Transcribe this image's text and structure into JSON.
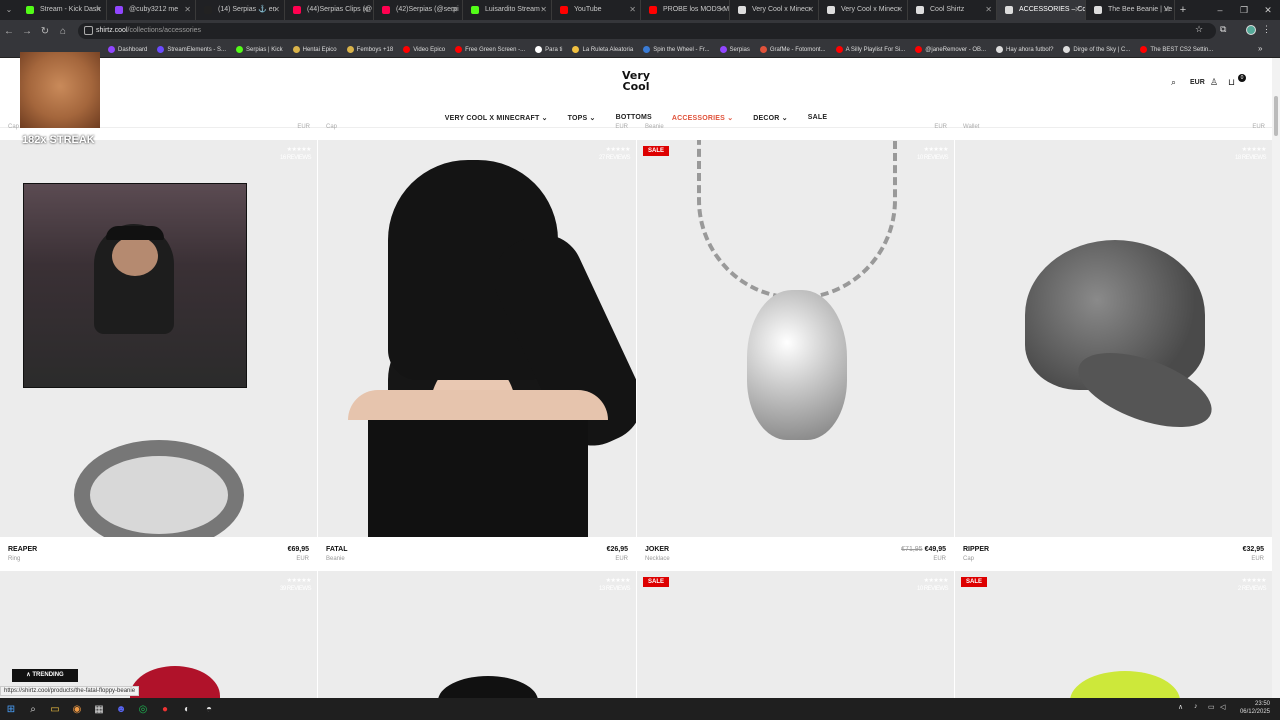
{
  "browser": {
    "tabs": [
      {
        "title": "Stream - Kick Dash",
        "color": "#53fc18"
      },
      {
        "title": "@cuby3212 me",
        "color": "#9146ff"
      },
      {
        "title": "(14) Serpias ⚓ en",
        "color": "#222222"
      },
      {
        "title": "(44)Serpias Clips (@",
        "color": "#ff0050"
      },
      {
        "title": "(42)Serpias (@serpi",
        "color": "#ff0050"
      },
      {
        "title": "Luisardito Stream -",
        "color": "#53fc18"
      },
      {
        "title": "YouTube",
        "color": "#ff0000"
      },
      {
        "title": "PROBE los MODS M",
        "color": "#ff0000"
      },
      {
        "title": "Very Cool x Minecr",
        "color": "#dddddd"
      },
      {
        "title": "Very Cool x Minecr",
        "color": "#dddddd"
      },
      {
        "title": "Cool Shirtz",
        "color": "#dddddd"
      },
      {
        "title": "ACCESSORIES – Coo",
        "color": "#dddddd",
        "active": true
      },
      {
        "title": "The Bee Beanie | Ve",
        "color": "#dddddd"
      }
    ],
    "url_host": "shirtz.cool",
    "url_path": "/collections/accessories",
    "bookmarks": [
      {
        "label": "Dashboard",
        "color": "#9146ff"
      },
      {
        "label": "StreamElements - S...",
        "color": "#6b4bff"
      },
      {
        "label": "Serpias | Kick",
        "color": "#53fc18"
      },
      {
        "label": "Hentai Epico",
        "color": "#d9b34a"
      },
      {
        "label": "Femboys +18",
        "color": "#d9b34a"
      },
      {
        "label": "Video Epico",
        "color": "#ff0000"
      },
      {
        "label": "Free Green Screen -...",
        "color": "#ff0000"
      },
      {
        "label": "Para ti",
        "color": "#ffffff"
      },
      {
        "label": "La Ruleta Aleatoria",
        "color": "#f0c040"
      },
      {
        "label": "Spin the Wheel - Fr...",
        "color": "#3a7bd5"
      },
      {
        "label": "Serpias",
        "color": "#9146ff"
      },
      {
        "label": "GrafMe - Fotomont...",
        "color": "#e0523a"
      },
      {
        "label": "A Silly Playlist For Si...",
        "color": "#ff0000"
      },
      {
        "label": "@janeRemover - OB...",
        "color": "#ff0000"
      },
      {
        "label": "Hay ahora futbol?",
        "color": "#dddddd"
      },
      {
        "label": "Dirge of the Sky | C...",
        "color": "#dddddd"
      },
      {
        "label": "The BEST CS2 Settin...",
        "color": "#ff0000"
      }
    ],
    "status_url": "https://shirtz.cool/products/the-fatal-floppy-beanie"
  },
  "site": {
    "logo_line1": "Very",
    "logo_line2": "Cool",
    "currency": "EUR",
    "cart_count": "0",
    "nav": [
      {
        "label": "VERY COOL X MINECRAFT",
        "chevron": true
      },
      {
        "label": "TOPS",
        "chevron": true
      },
      {
        "label": "BOTTOMS",
        "chevron": false
      },
      {
        "label": "ACCESSORIES",
        "chevron": true,
        "active": true
      },
      {
        "label": "DECOR",
        "chevron": true
      },
      {
        "label": "SALE",
        "chevron": false
      }
    ],
    "accent_color": "#e0523a",
    "sale_color": "#d00000"
  },
  "prev_row": {
    "types": [
      "Cap",
      "Cap",
      "Beanie",
      "Wallet"
    ],
    "currency": [
      "EUR",
      "EUR",
      "EUR",
      "EUR"
    ]
  },
  "products_row1": [
    {
      "name": "REAPER",
      "type": "Ring",
      "price": "€69,95",
      "currency": "EUR",
      "reviews": "16 REVIEWS",
      "sale": false
    },
    {
      "name": "FATAL",
      "type": "Beanie",
      "price": "€26,95",
      "currency": "EUR",
      "reviews": "27 REVIEWS",
      "sale": false
    },
    {
      "name": "JOKER",
      "type": "Necklace",
      "was_price": "€71,95",
      "price": "€49,95",
      "currency": "EUR",
      "reviews": "10 REVIEWS",
      "sale": true
    },
    {
      "name": "RIPPER",
      "type": "Cap",
      "price": "€32,95",
      "currency": "EUR",
      "reviews": "18 REVIEWS",
      "sale": false
    }
  ],
  "products_row2": [
    {
      "reviews": "39 REVIEWS",
      "sale": false
    },
    {
      "reviews": "13 REVIEWS",
      "sale": false
    },
    {
      "reviews": "10 REVIEWS",
      "sale": true
    },
    {
      "reviews": "2 REVIEWS",
      "sale": true
    }
  ],
  "stars": "★★★★★",
  "sale_label": "SALE",
  "overlay": {
    "streak": "182x STREAK",
    "trending": "∧ TRENDING"
  },
  "system": {
    "time": "23:50",
    "date": "06/12/2025"
  }
}
